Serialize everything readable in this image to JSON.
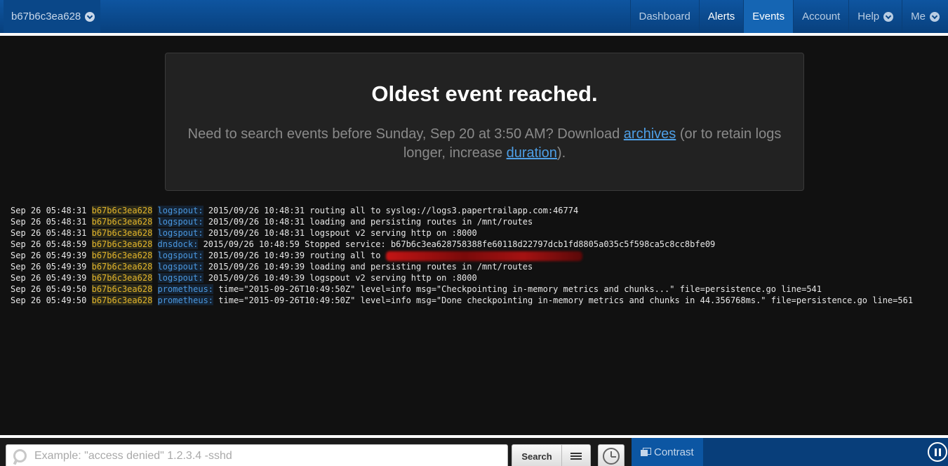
{
  "header": {
    "system_name": "b67b6c3ea628",
    "nav": [
      {
        "label": "Dashboard"
      },
      {
        "label": "Alerts"
      },
      {
        "label": "Events"
      },
      {
        "label": "Account"
      },
      {
        "label": "Help"
      },
      {
        "label": "Me"
      }
    ]
  },
  "notice": {
    "title": "Oldest event reached.",
    "text_before": "Need to search events before Sunday, Sep 20 at 3:50 AM? Download ",
    "archives_link": "archives",
    "text_middle": " (or to retain logs longer, increase ",
    "duration_link": "duration",
    "text_after": ")."
  },
  "log": [
    {
      "time": "Sep 26 05:48:31",
      "host": "b67b6c3ea628",
      "program": "logspout:",
      "message": "2015/09/26 10:48:31 routing all to syslog://logs3.papertrailapp.com:46774"
    },
    {
      "time": "Sep 26 05:48:31",
      "host": "b67b6c3ea628",
      "program": "logspout:",
      "message": "2015/09/26 10:48:31 loading and persisting routes in /mnt/routes"
    },
    {
      "time": "Sep 26 05:48:31",
      "host": "b67b6c3ea628",
      "program": "logspout:",
      "message": "2015/09/26 10:48:31 logspout v2 serving http on :8000"
    },
    {
      "time": "Sep 26 05:48:59",
      "host": "b67b6c3ea628",
      "program": "dnsdock:",
      "message": "2015/09/26 10:48:59 Stopped service: b67b6c3ea628758388fe60118d22797dcb1fd8805a035c5f598ca5c8cc8bfe09"
    },
    {
      "time": "Sep 26 05:49:39",
      "host": "b67b6c3ea628",
      "program": "logspout:",
      "message": "2015/09/26 10:49:39 routing all to "
    },
    {
      "time": "Sep 26 05:49:39",
      "host": "b67b6c3ea628",
      "program": "logspout:",
      "message": "2015/09/26 10:49:39 loading and persisting routes in /mnt/routes"
    },
    {
      "time": "Sep 26 05:49:39",
      "host": "b67b6c3ea628",
      "program": "logspout:",
      "message": "2015/09/26 10:49:39 logspout v2 serving http on :8000"
    },
    {
      "time": "Sep 26 05:49:50",
      "host": "b67b6c3ea628",
      "program": "prometheus:",
      "message": "time=\"2015-09-26T10:49:50Z\" level=info msg=\"Checkpointing in-memory metrics and chunks...\" file=persistence.go line=541"
    },
    {
      "time": "Sep 26 05:49:50",
      "host": "b67b6c3ea628",
      "program": "prometheus:",
      "message": "time=\"2015-09-26T10:49:50Z\" level=info msg=\"Done checkpointing in-memory metrics and chunks in 44.356768ms.\" file=persistence.go line=561"
    }
  ],
  "footer": {
    "search_placeholder": "Example: \"access denied\" 1.2.3.4 -sshd",
    "search_button": "Search",
    "contrast_label": "Contrast"
  }
}
